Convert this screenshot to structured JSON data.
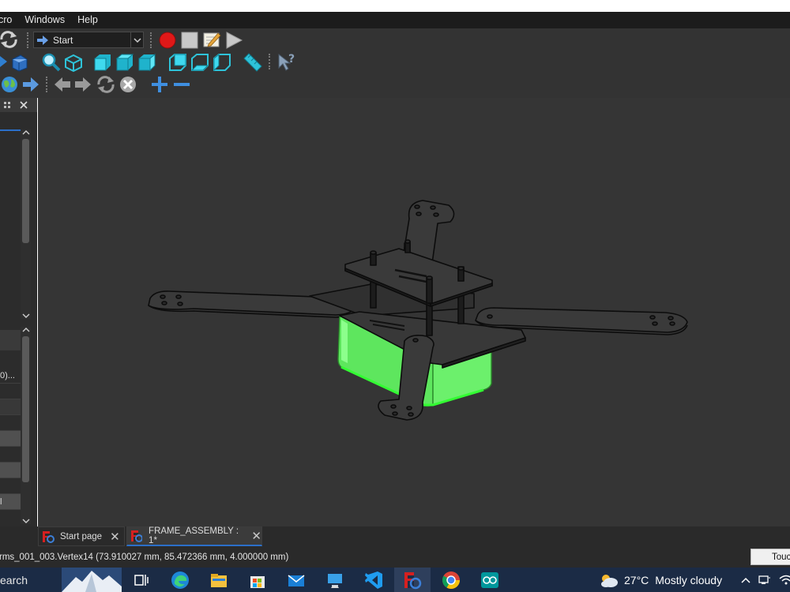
{
  "menu": {
    "items": [
      "cro",
      "Windows",
      "Help"
    ]
  },
  "macro": {
    "selected": "Start"
  },
  "left_panel": {
    "rows": [
      "0)...",
      "",
      "",
      "",
      "",
      "",
      "",
      "",
      "l"
    ]
  },
  "tabs": [
    {
      "label": "Start page",
      "close": "✕"
    },
    {
      "label": "FRAME_ASSEMBLY : 1*",
      "close": "✕"
    }
  ],
  "status": {
    "message": "rms_001_003.Vertex14 (73.910027 mm, 85.472366 mm, 4.000000 mm)",
    "right_button": "Touch"
  },
  "taskbar": {
    "search_label": "earch",
    "weather_temp": "27°C",
    "weather_condition": "Mostly cloudy"
  },
  "colors": {
    "viewport_bg": "#353535",
    "highlight_green": "#66ff66",
    "record_red": "#e01818",
    "accent_blue": "#2b6fc9",
    "taskbar_bg": "#1b2b45"
  }
}
